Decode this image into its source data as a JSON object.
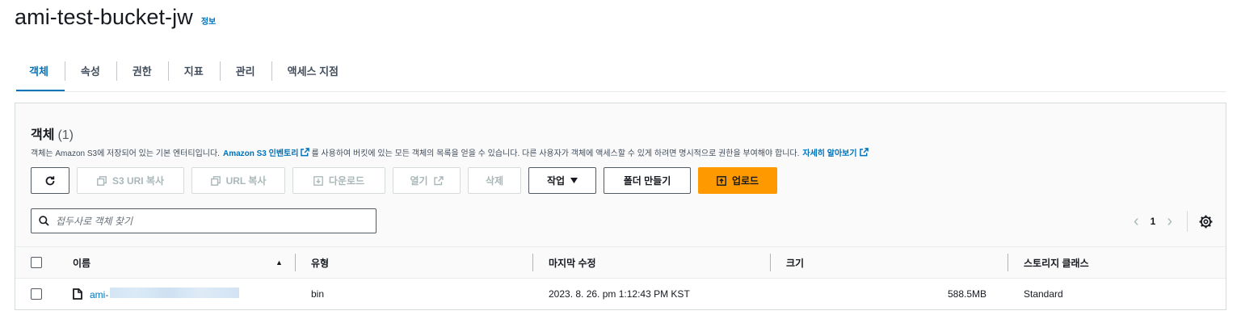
{
  "header": {
    "title": "ami-test-bucket-jw",
    "info_label": "정보"
  },
  "tabs": [
    {
      "label": "객체",
      "active": true
    },
    {
      "label": "속성"
    },
    {
      "label": "권한"
    },
    {
      "label": "지표"
    },
    {
      "label": "관리"
    },
    {
      "label": "액세스 지점"
    }
  ],
  "objects": {
    "heading": "객체",
    "count": "(1)",
    "description": {
      "part1": "객체는 Amazon S3에 저장되어 있는 기본 엔터티입니다.",
      "link1": "Amazon S3 인벤토리",
      "part2": "를 사용하여 버킷에 있는 모든 객체의 목록을 얻을 수 있습니다. 다른 사용자가 객체에 액세스할 수 있게 하려면 명시적으로 권한을 부여해야 합니다.",
      "link2": "자세히 알아보기"
    },
    "toolbar": {
      "copy_s3_uri": "S3 URI 복사",
      "copy_url": "URL 복사",
      "download": "다운로드",
      "open": "열기",
      "delete": "삭제",
      "actions": "작업",
      "create_folder": "폴더 만들기",
      "upload": "업로드"
    },
    "search": {
      "placeholder": "접두사로 객체 찾기"
    },
    "pagination": {
      "current_page": "1"
    },
    "columns": {
      "name": "이름",
      "type": "유형",
      "last_modified": "마지막 수정",
      "size": "크기",
      "storage_class": "스토리지 클래스"
    },
    "rows": [
      {
        "name_visible": "ami-",
        "type": "bin",
        "last_modified": "2023. 8. 26. pm 1:12:43 PM KST",
        "size": "588.5MB",
        "storage_class": "Standard"
      }
    ]
  },
  "colors": {
    "link": "#0073bb",
    "primary_button": "#ff9900",
    "text": "#16191f"
  }
}
